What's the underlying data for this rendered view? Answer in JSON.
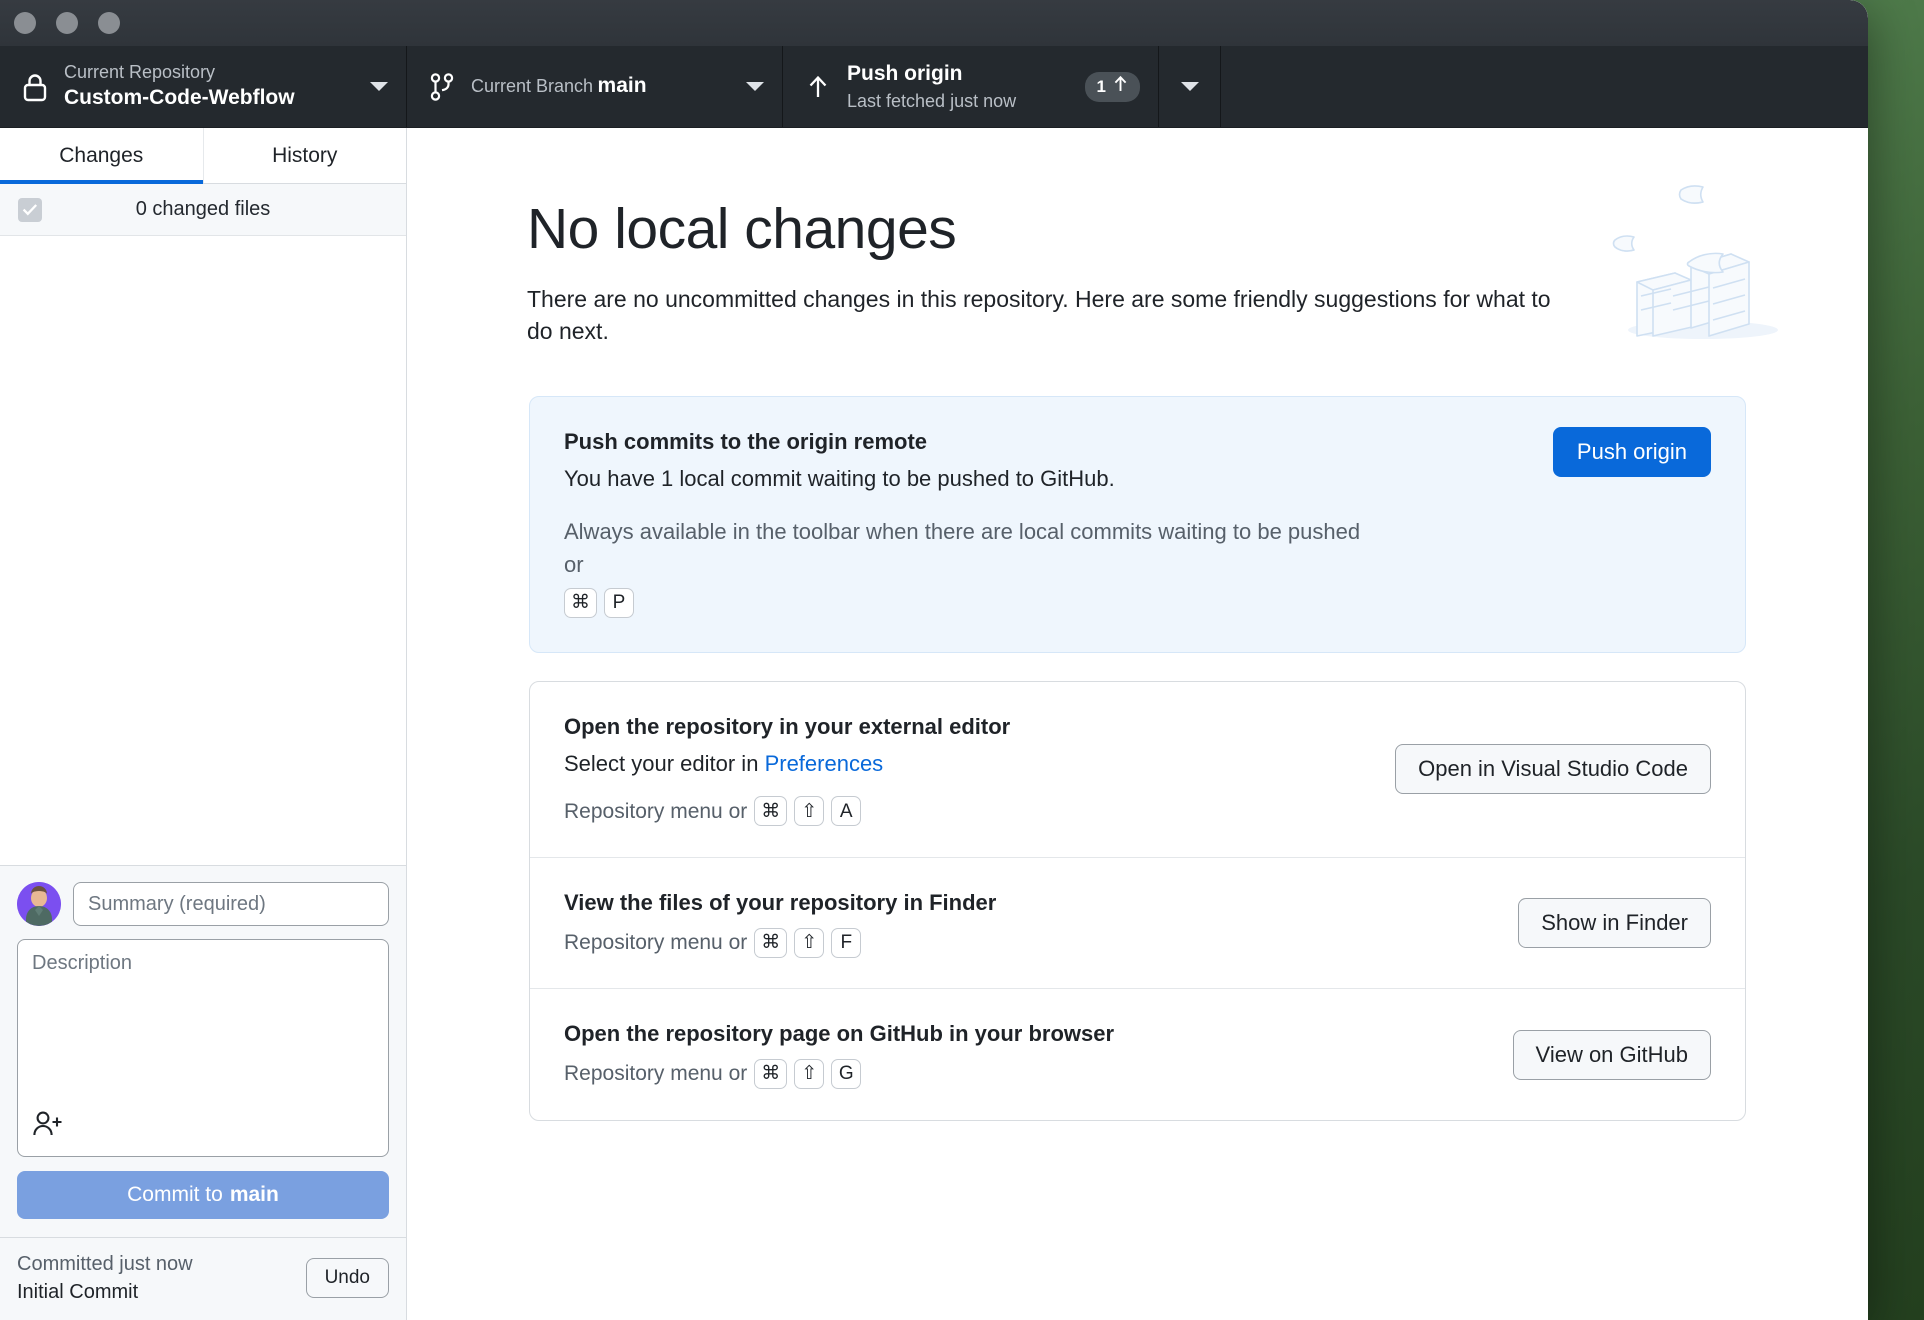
{
  "window": {
    "traffic_lights": [
      "close",
      "minimize",
      "zoom"
    ]
  },
  "toolbar": {
    "repository": {
      "label": "Current Repository",
      "value": "Custom-Code-Webflow",
      "icon": "lock-icon"
    },
    "branch": {
      "label": "Current Branch",
      "value": "main",
      "icon": "branch-icon"
    },
    "push": {
      "label": "Push origin",
      "sublabel": "Last fetched just now",
      "icon": "arrow-up-icon",
      "badge_count": "1",
      "badge_icon": "arrow-up-icon"
    }
  },
  "sidebar": {
    "tabs": [
      {
        "label": "Changes",
        "active": true
      },
      {
        "label": "History",
        "active": false
      }
    ],
    "changed_files_text": "0 changed files",
    "commit_form": {
      "summary_placeholder": "Summary (required)",
      "summary_value": "",
      "description_placeholder": "Description",
      "description_value": "",
      "add_coauthor_icon": "add-person-icon",
      "commit_button_prefix": "Commit to",
      "commit_button_branch": "main"
    },
    "undo_bar": {
      "status": "Committed just now",
      "commit_title": "Initial Commit",
      "undo_label": "Undo"
    }
  },
  "main": {
    "title": "No local changes",
    "subtitle": "There are no uncommitted changes in this repository. Here are some friendly suggestions for what to do next.",
    "illustration": "paper-boxes-illustration",
    "push_card": {
      "title": "Push commits to the origin remote",
      "description": "You have 1 local commit waiting to be pushed to GitHub.",
      "note_prefix": "Always available in the toolbar when there are local commits waiting to be pushed or",
      "shortcut": [
        "⌘",
        "P"
      ],
      "button_label": "Push origin"
    },
    "suggestions": [
      {
        "title": "Open the repository in your external editor",
        "desc_prefix": "Select your editor in",
        "desc_link": "Preferences",
        "meta_prefix": "Repository menu or",
        "shortcut": [
          "⌘",
          "⇧",
          "A"
        ],
        "button_label": "Open in Visual Studio Code"
      },
      {
        "title": "View the files of your repository in Finder",
        "desc_prefix": "",
        "desc_link": "",
        "meta_prefix": "Repository menu or",
        "shortcut": [
          "⌘",
          "⇧",
          "F"
        ],
        "button_label": "Show in Finder"
      },
      {
        "title": "Open the repository page on GitHub in your browser",
        "desc_prefix": "",
        "desc_link": "",
        "meta_prefix": "Repository menu or",
        "shortcut": [
          "⌘",
          "⇧",
          "G"
        ],
        "button_label": "View on GitHub"
      }
    ]
  },
  "colors": {
    "accent": "#0969da",
    "toolbar_bg": "#24292e",
    "titlebar_bg": "#32373d",
    "card_blue_bg": "#eff6fd",
    "commit_button": "#7aa0e0"
  }
}
